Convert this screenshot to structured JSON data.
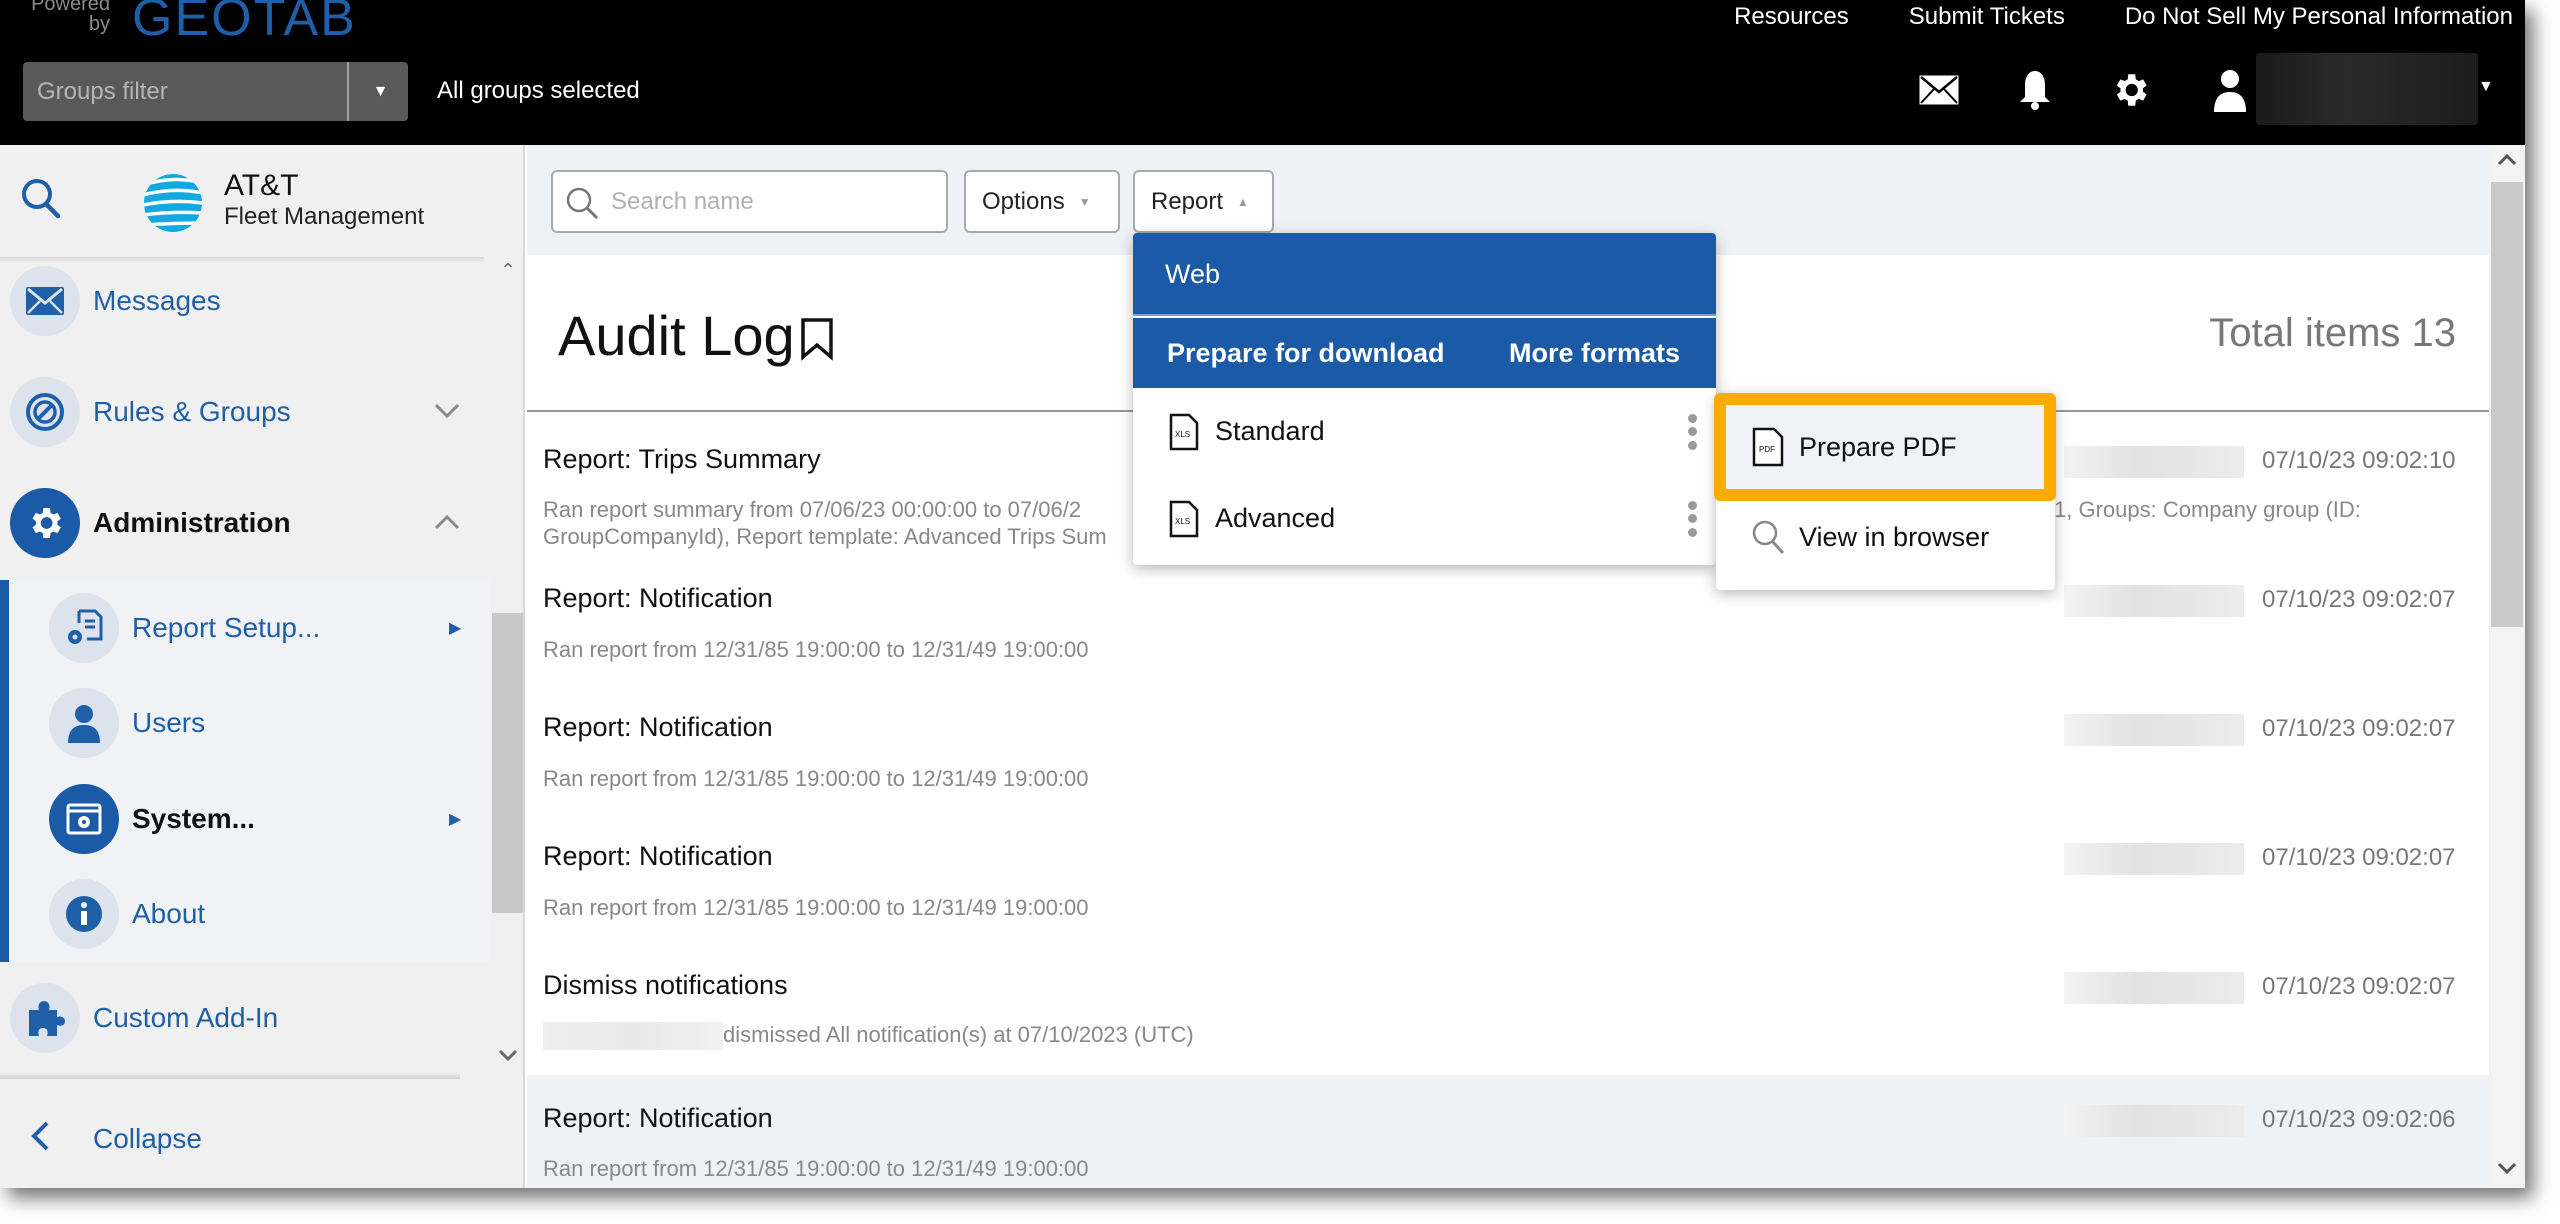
{
  "header": {
    "powered_by": "Powered by",
    "brand": "GEOTAB",
    "links": [
      "Resources",
      "Submit Tickets",
      "Do Not Sell My Personal Information"
    ],
    "groups_filter_placeholder": "Groups filter",
    "groups_status": "All groups selected",
    "icons": [
      "mail-icon",
      "bell-icon",
      "gear-icon",
      "user-icon"
    ]
  },
  "sidebar": {
    "logo_name": "AT&T",
    "logo_sub": "Fleet Management",
    "items": [
      {
        "label": "Messages",
        "icon": "envelope-icon"
      },
      {
        "label": "Rules & Groups",
        "icon": "rules-icon",
        "expand": "chevron-down"
      },
      {
        "label": "Administration",
        "icon": "gear-icon",
        "expand": "chevron-up",
        "active": true
      },
      {
        "label": "Report Setup...",
        "icon": "report-setup-icon",
        "sub": true,
        "has_submenu": true
      },
      {
        "label": "Users",
        "icon": "user-icon",
        "sub": true
      },
      {
        "label": "System...",
        "icon": "system-icon",
        "sub": true,
        "has_submenu": true,
        "active": true
      },
      {
        "label": "About",
        "icon": "info-icon",
        "sub": true
      },
      {
        "label": "Custom Add-In",
        "icon": "puzzle-icon"
      }
    ],
    "collapse_label": "Collapse"
  },
  "toolbar": {
    "search_placeholder": "Search name",
    "options_label": "Options",
    "report_label": "Report"
  },
  "page": {
    "title": "Audit Log",
    "total_items": "Total items 13"
  },
  "report_menu": {
    "web_label": "Web",
    "prepare_label": "Prepare for download",
    "more_formats_label": "More formats",
    "items": [
      {
        "label": "Standard",
        "icon": "xls-file-icon"
      },
      {
        "label": "Advanced",
        "icon": "xls-file-icon"
      }
    ],
    "submenu": [
      {
        "label": "Prepare PDF",
        "icon": "pdf-file-icon",
        "highlighted": true
      },
      {
        "label": "View in browser",
        "icon": "search-icon"
      }
    ],
    "highlight_color": "#f9ab00"
  },
  "rows": [
    {
      "title": "Report: Trips Summary",
      "desc_line1": "Ran report summary from 07/06/23 00:00:00 to 07/06/2",
      "desc_line1_right": "1, Groups: Company group (ID:",
      "desc_line2": "GroupCompanyId), Report template: Advanced Trips Sum",
      "time": "07/10/23 09:02:10"
    },
    {
      "title": "Report: Notification",
      "desc_line1": "Ran report from 12/31/85 19:00:00 to 12/31/49 19:00:00",
      "time": "07/10/23 09:02:07"
    },
    {
      "title": "Report: Notification",
      "desc_line1": "Ran report from 12/31/85 19:00:00 to 12/31/49 19:00:00",
      "time": "07/10/23 09:02:07"
    },
    {
      "title": "Report: Notification",
      "desc_line1": "Ran report from 12/31/85 19:00:00 to 12/31/49 19:00:00",
      "time": "07/10/23 09:02:07"
    },
    {
      "title": "Dismiss notifications",
      "desc_line1": "dismissed All notification(s) at 07/10/2023 (UTC)",
      "time": "07/10/23 09:02:07"
    },
    {
      "title": "Report: Notification",
      "desc_line1": "Ran report from 12/31/85 19:00:00 to 12/31/49 19:00:00",
      "time": "07/10/23 09:02:06"
    }
  ],
  "colors": {
    "brand_blue": "#1a5aa6",
    "header_bg": "#000000",
    "highlight": "#f9ab00"
  }
}
